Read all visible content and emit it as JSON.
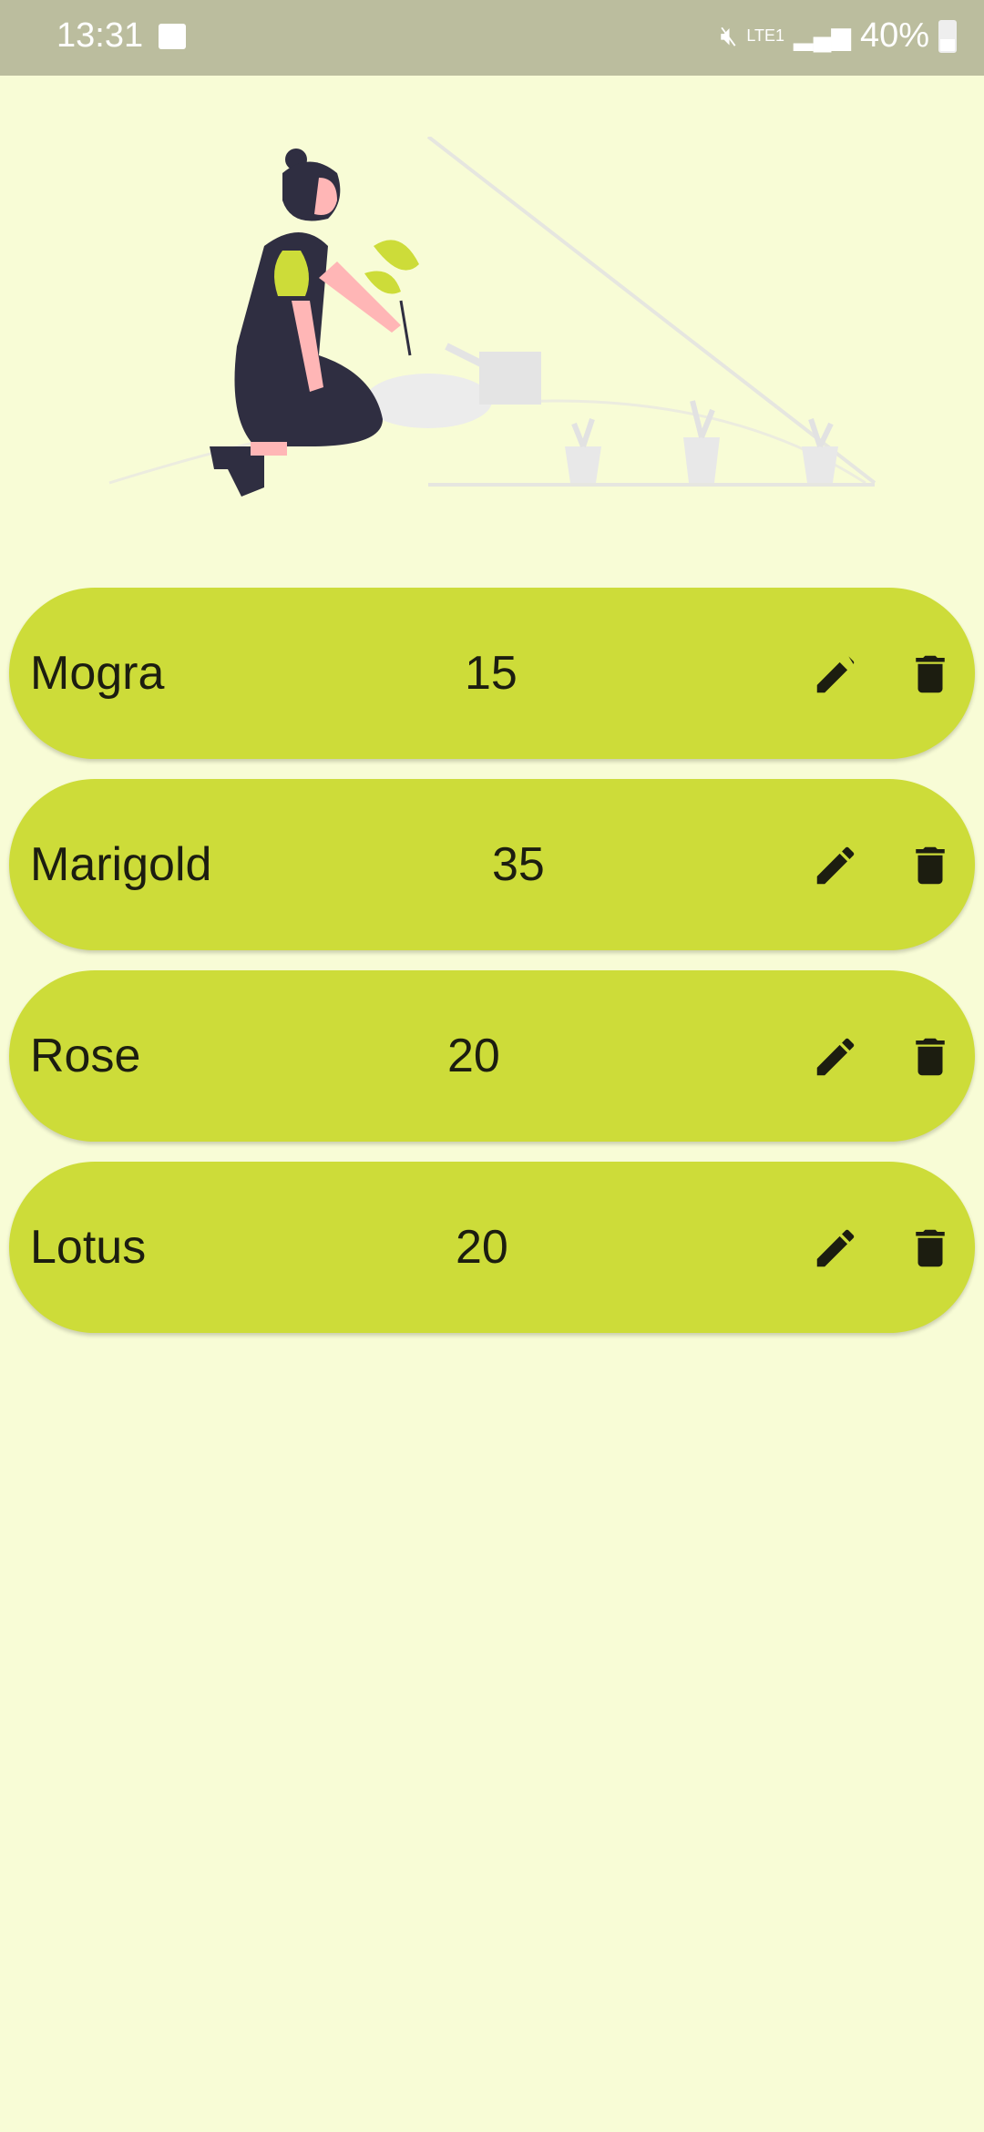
{
  "status_bar": {
    "time": "13:31",
    "battery": "40%",
    "network": "LTE1"
  },
  "colors": {
    "background": "#f8fcd6",
    "card": "#cddc39",
    "status_bar": "#bbbd9e",
    "text": "#1c1d10"
  },
  "items": [
    {
      "name": "Mogra",
      "quantity": "15"
    },
    {
      "name": "Marigold",
      "quantity": "35"
    },
    {
      "name": "Rose",
      "quantity": "20"
    },
    {
      "name": "Lotus",
      "quantity": "20"
    }
  ]
}
